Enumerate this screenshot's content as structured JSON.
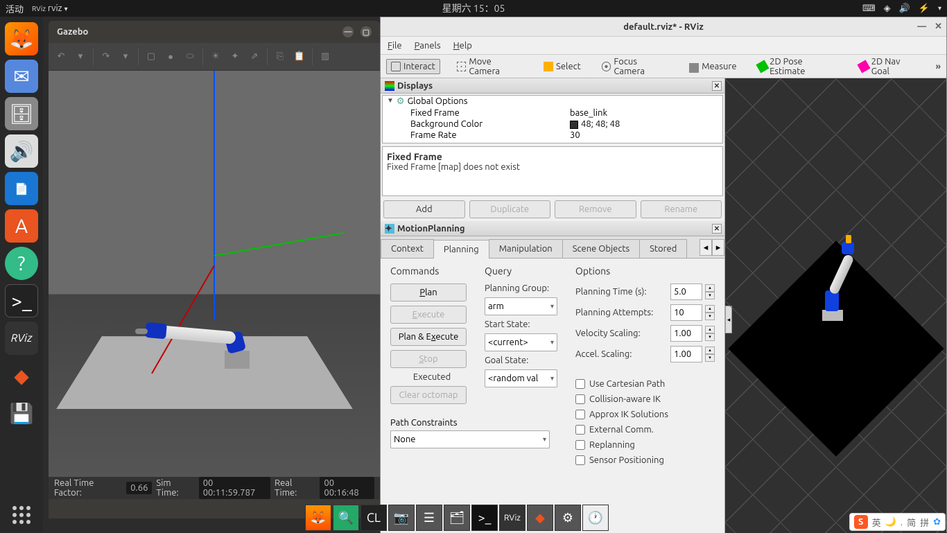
{
  "topbar": {
    "activities": "活动",
    "app": "rviz",
    "datetime": "星期六 15：05"
  },
  "gazebo": {
    "title": "Gazebo",
    "status": {
      "rtf_label": "Real Time Factor:",
      "rtf": "0.66",
      "simtime_label": "Sim Time:",
      "simtime": "00 00:11:59.787",
      "realtime_label": "Real Time:",
      "realtime": "00 00:16:48"
    }
  },
  "rviz": {
    "title": "default.rviz* - RViz",
    "menu": {
      "file": "File",
      "panels": "Panels",
      "help": "Help"
    },
    "tools": {
      "interact": "Interact",
      "move": "Move Camera",
      "select": "Select",
      "focus": "Focus Camera",
      "measure": "Measure",
      "pose": "2D Pose Estimate",
      "nav": "2D Nav Goal",
      "more": "»"
    },
    "displays": {
      "title": "Displays",
      "global_options": "Global Options",
      "fixed_frame_k": "Fixed Frame",
      "fixed_frame_v": "base_link",
      "bgcolor_k": "Background Color",
      "bgcolor_v": "48; 48; 48",
      "framerate_k": "Frame Rate",
      "framerate_v": "30",
      "desc_title": "Fixed Frame",
      "desc_body": "Fixed Frame [map] does not exist",
      "btn_add": "Add",
      "btn_dup": "Duplicate",
      "btn_rem": "Remove",
      "btn_ren": "Rename"
    },
    "mp": {
      "title": "MotionPlanning",
      "tabs": {
        "context": "Context",
        "planning": "Planning",
        "manipulation": "Manipulation",
        "scene": "Scene Objects",
        "stored": "Stored"
      },
      "commands": {
        "h": "Commands",
        "plan": "Plan",
        "execute": "Execute",
        "plan_execute": "Plan & Execute",
        "stop": "Stop",
        "executed": "Executed",
        "clear": "Clear octomap"
      },
      "query": {
        "h": "Query",
        "group_l": "Planning Group:",
        "group_v": "arm",
        "start_l": "Start State:",
        "start_v": "<current>",
        "goal_l": "Goal State:",
        "goal_v": "<random val"
      },
      "options": {
        "h": "Options",
        "time_l": "Planning Time (s):",
        "time_v": "5.0",
        "attempts_l": "Planning Attempts:",
        "attempts_v": "10",
        "vscale_l": "Velocity Scaling:",
        "vscale_v": "1.00",
        "ascale_l": "Accel. Scaling:",
        "ascale_v": "1.00",
        "cartesian": "Use Cartesian Path",
        "collision": "Collision-aware IK",
        "approx": "Approx IK Solutions",
        "external": "External Comm.",
        "replanning": "Replanning",
        "sensor": "Sensor Positioning"
      },
      "path": {
        "h": "Path Constraints",
        "v": "None"
      }
    }
  },
  "ime": {
    "lang": "英",
    "layout": "简",
    "mode": "拼"
  }
}
